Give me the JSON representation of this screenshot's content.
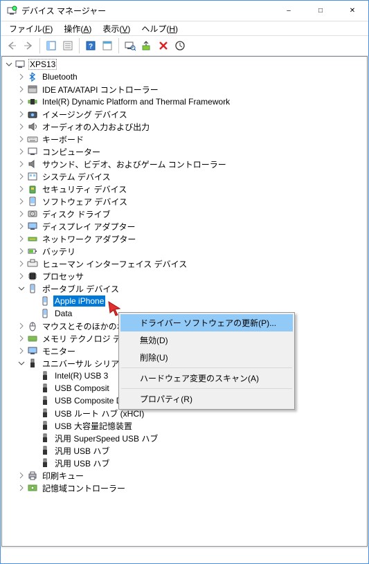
{
  "window": {
    "title": "デバイス マネージャー"
  },
  "menu": {
    "file": "ファイル(F)",
    "action": "操作(A)",
    "view": "表示(V)",
    "help": "ヘルプ(H)"
  },
  "root": {
    "label": "XPS13"
  },
  "nodes": [
    {
      "label": "Bluetooth",
      "icon": "bluetooth"
    },
    {
      "label": "IDE ATA/ATAPI コントローラー",
      "icon": "ide"
    },
    {
      "label": "Intel(R) Dynamic Platform and Thermal Framework",
      "icon": "intel"
    },
    {
      "label": "イメージング デバイス",
      "icon": "imaging"
    },
    {
      "label": "オーディオの入力および出力",
      "icon": "audio"
    },
    {
      "label": "キーボード",
      "icon": "keyboard"
    },
    {
      "label": "コンピューター",
      "icon": "computer"
    },
    {
      "label": "サウンド、ビデオ、およびゲーム コントローラー",
      "icon": "sound"
    },
    {
      "label": "システム デバイス",
      "icon": "system"
    },
    {
      "label": "セキュリティ デバイス",
      "icon": "security"
    },
    {
      "label": "ソフトウェア デバイス",
      "icon": "software"
    },
    {
      "label": "ディスク ドライブ",
      "icon": "disk"
    },
    {
      "label": "ディスプレイ アダプター",
      "icon": "display"
    },
    {
      "label": "ネットワーク アダプター",
      "icon": "network"
    },
    {
      "label": "バッテリ",
      "icon": "battery"
    },
    {
      "label": "ヒューマン インターフェイス デバイス",
      "icon": "hid"
    },
    {
      "label": "プロセッサ",
      "icon": "cpu"
    }
  ],
  "portable": {
    "label": "ポータブル デバイス",
    "items": [
      "Apple iPhone",
      "Data"
    ]
  },
  "mouse": {
    "label": "マウスとそのほかのポ"
  },
  "memory": {
    "label": "メモリ テクノロジ デバ"
  },
  "monitor": {
    "label": "モニター"
  },
  "usb": {
    "label": "ユニバーサル シリアル",
    "items": [
      "Intel(R) USB 3",
      "USB Composit",
      "USB Composite Device",
      "USB ルート ハブ (xHCI)",
      "USB 大容量記憶装置",
      "汎用 SuperSpeed USB ハブ",
      "汎用 USB ハブ",
      "汎用 USB ハブ"
    ]
  },
  "print": {
    "label": "印刷キュー"
  },
  "storage": {
    "label": "記憶域コントローラー"
  },
  "context": {
    "update": "ドライバー ソフトウェアの更新(P)...",
    "disable": "無効(D)",
    "delete": "削除(U)",
    "scan": "ハードウェア変更のスキャン(A)",
    "properties": "プロパティ(R)"
  }
}
